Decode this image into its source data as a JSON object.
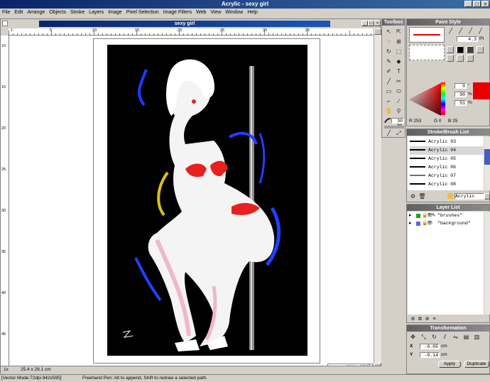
{
  "app": {
    "title": "Acrylic - sexy girl",
    "document_title": "sexy girl",
    "page_name": "sexy girl"
  },
  "menu": [
    "File",
    "Edit",
    "Arrange",
    "Objects",
    "Stroke",
    "Layers",
    "Image",
    "Pixel Selection",
    "Image Filters",
    "Web",
    "View",
    "Window",
    "Help"
  ],
  "ruler": {
    "h_ticks": [
      "1",
      "5",
      "10",
      "15",
      "20",
      "25",
      "30",
      "35"
    ],
    "v_ticks": [
      "10",
      "15",
      "20",
      "25",
      "30",
      "35",
      "40",
      "45"
    ]
  },
  "status": {
    "zoom": "1x",
    "mode": "[Vector Mode:72dpi 842x595]",
    "hint": "Freehand Pen: Alt to append, Shift to redraw a selected path.",
    "coords": "25.4 x 29.1 cm"
  },
  "toolbox": {
    "title": "Toolbox",
    "brush_size": "30 Pt"
  },
  "paint_style": {
    "title": "Paint Style",
    "size_value": "4.3",
    "size_unit": "Pt",
    "hue_value": "0",
    "sat_value": "90",
    "bri_value": "51",
    "percent": "%",
    "r": "R 253",
    "g": "G 0",
    "b": "B 25",
    "accent": "#e80000"
  },
  "stroke_list": {
    "title": "Stroke/Brush List",
    "items": [
      "Acrylic 03",
      "Acrylic 04",
      "Acrylic 05",
      "Acrylic 06",
      "Acrylic 07",
      "Acrylic 08"
    ],
    "selected_index": 1,
    "folder": "Acrylic"
  },
  "layer_list": {
    "title": "Layer List",
    "layers": [
      {
        "name": "\"brushes\"",
        "color": "#20a020"
      },
      {
        "name": "\"background\"",
        "color": "#6060f0"
      }
    ]
  },
  "transformation": {
    "title": "Transformation",
    "x_label": "X",
    "y_label": "Y",
    "x_value": "-0.05",
    "y_value": "-0.14",
    "unit": "cm",
    "apply": "Apply",
    "duplicate": "Duplicate"
  }
}
